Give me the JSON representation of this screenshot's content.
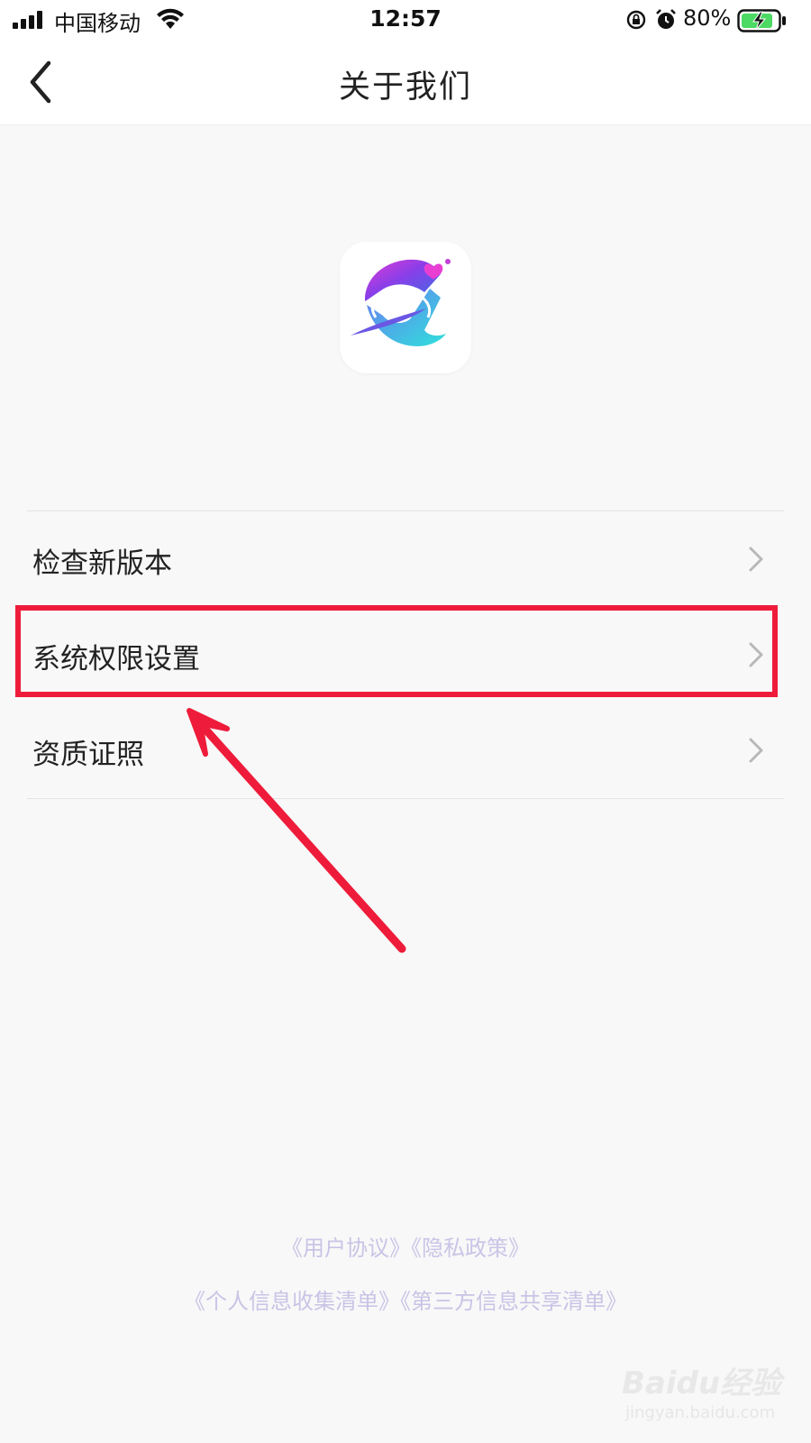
{
  "status_bar": {
    "carrier": "中国移动",
    "time": "12:57",
    "battery": "80%"
  },
  "nav": {
    "title": "关于我们"
  },
  "menu": {
    "items": [
      {
        "label": "检查新版本"
      },
      {
        "label": "系统权限设置"
      },
      {
        "label": "资质证照"
      }
    ]
  },
  "footer": {
    "user_agreement": "《用户协议》",
    "privacy_policy": "《隐私政策》",
    "personal_info_list": "《个人信息收集清单》",
    "third_party_list": "《第三方信息共享清单》"
  },
  "watermark": {
    "brand": "Baidu经验",
    "url": "jingyan.baidu.com"
  },
  "colors": {
    "highlight": "#ee1c3a",
    "footer_link": "#c9c4e6",
    "battery_fill": "#4cd964"
  }
}
